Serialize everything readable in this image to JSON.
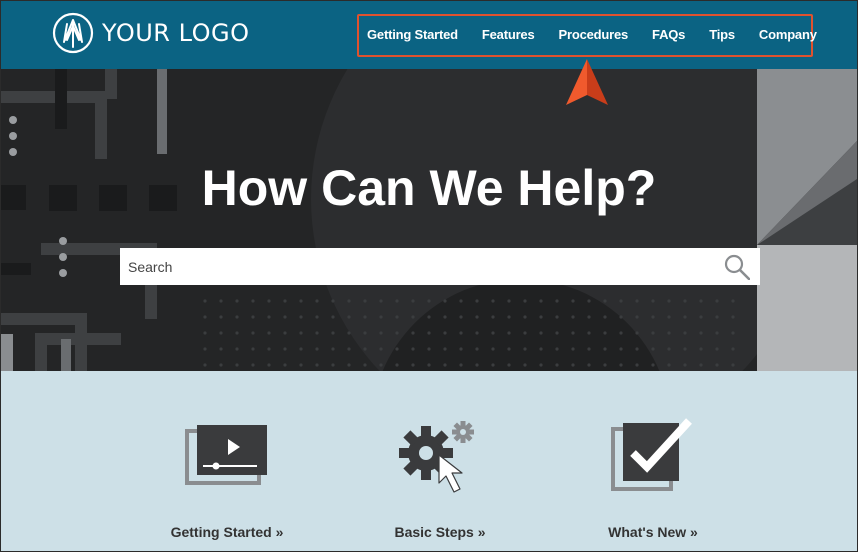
{
  "header": {
    "logo_text": "YOUR LOGO",
    "nav": [
      {
        "label": "Getting Started"
      },
      {
        "label": "Features"
      },
      {
        "label": "Procedures"
      },
      {
        "label": "FAQs"
      },
      {
        "label": "Tips"
      },
      {
        "label": "Company"
      }
    ]
  },
  "hero": {
    "title": "How Can We Help?",
    "search_placeholder": "Search"
  },
  "tiles": [
    {
      "label": "Getting Started »",
      "icon": "video-player-icon"
    },
    {
      "label": "Basic Steps »",
      "icon": "gear-cursor-icon"
    },
    {
      "label": "What's New »",
      "icon": "checkbox-icon"
    }
  ],
  "colors": {
    "header": "#0b6383",
    "highlight": "#e0522e",
    "hero": "#242526",
    "tiles_bg": "#cde0e7",
    "icon": "#3a3b3d"
  }
}
